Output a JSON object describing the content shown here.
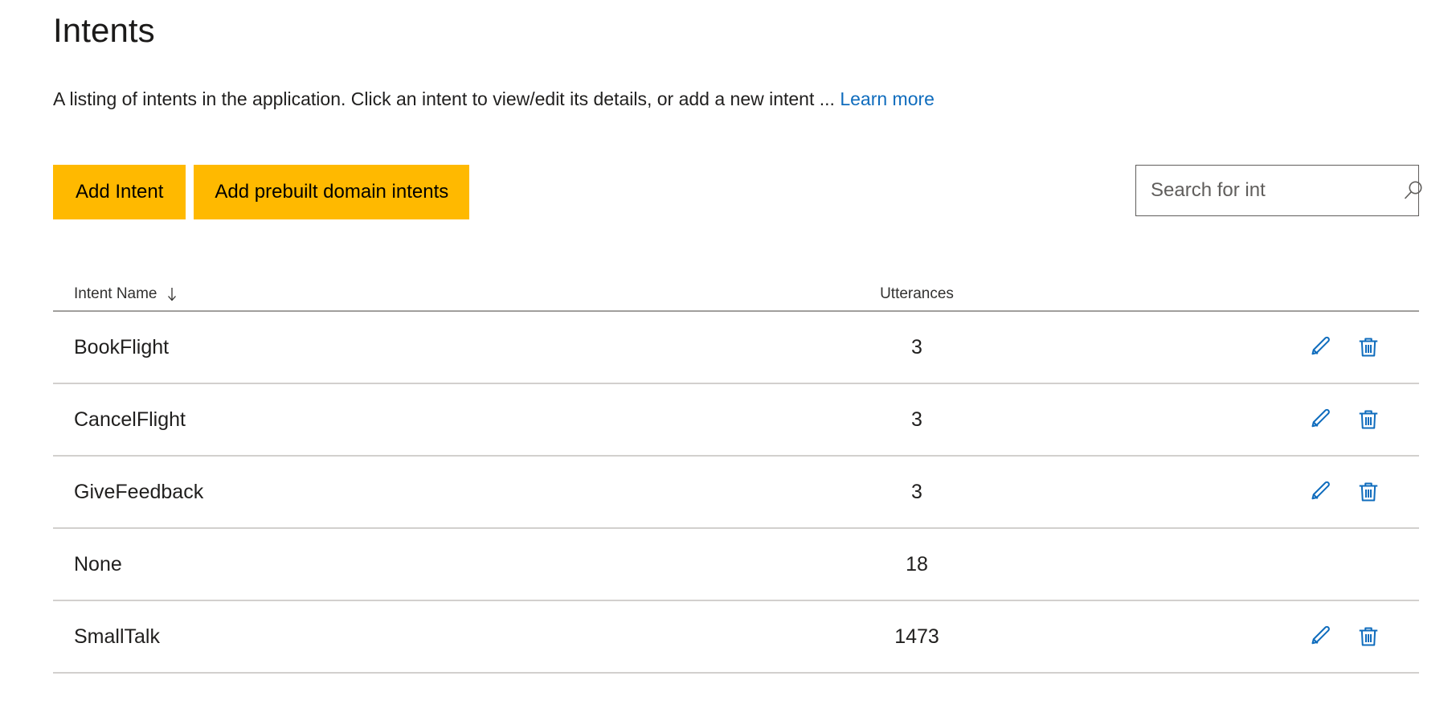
{
  "page": {
    "title": "Intents",
    "description_before_link": "A listing of intents in the application. Click an intent to view/edit its details, or add a new intent ... ",
    "learn_more_label": "Learn more"
  },
  "toolbar": {
    "add_intent_label": "Add Intent",
    "add_prebuilt_label": "Add prebuilt domain intents",
    "search_placeholder": "Search for int",
    "search_value": "",
    "search_icon": "search-icon"
  },
  "table": {
    "columns": {
      "name": "Intent Name",
      "utterances": "Utterances",
      "sort_indicator": "↓"
    },
    "rows": [
      {
        "name": "BookFlight",
        "utterances": "3",
        "has_actions": true
      },
      {
        "name": "CancelFlight",
        "utterances": "3",
        "has_actions": true
      },
      {
        "name": "GiveFeedback",
        "utterances": "3",
        "has_actions": true
      },
      {
        "name": "None",
        "utterances": "18",
        "has_actions": false
      },
      {
        "name": "SmallTalk",
        "utterances": "1473",
        "has_actions": true
      }
    ],
    "row_actions": {
      "edit_icon": "pencil-icon",
      "delete_icon": "trash-icon"
    }
  },
  "colors": {
    "accent_button": "#ffb900",
    "link": "#0f6cbd",
    "icon_blue": "#0f6cbd",
    "header_rule": "#a19f9d",
    "row_rule": "#d2d0ce",
    "text": "#201f1e",
    "muted_text": "#605e5c"
  }
}
